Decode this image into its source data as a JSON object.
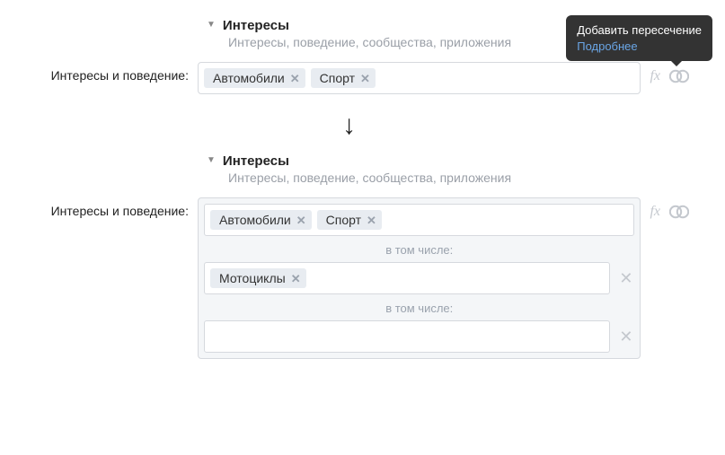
{
  "section1": {
    "title": "Интересы",
    "subtitle": "Интересы, поведение, сообщества, приложения",
    "field_label": "Интересы и поведение:",
    "tokens": [
      "Автомобили",
      "Спорт"
    ],
    "fx": "fx",
    "tooltip": {
      "title": "Добавить пересечение",
      "link": "Подробнее"
    }
  },
  "section2": {
    "title": "Интересы",
    "subtitle": "Интересы, поведение, сообщества, приложения",
    "field_label": "Интересы и поведение:",
    "fx": "fx",
    "rows": [
      {
        "tokens": [
          "Автомобили",
          "Спорт"
        ]
      }
    ],
    "caption": "в том числе:",
    "sub_rows": [
      {
        "tokens": [
          "Мотоциклы"
        ]
      },
      {
        "tokens": []
      }
    ]
  }
}
